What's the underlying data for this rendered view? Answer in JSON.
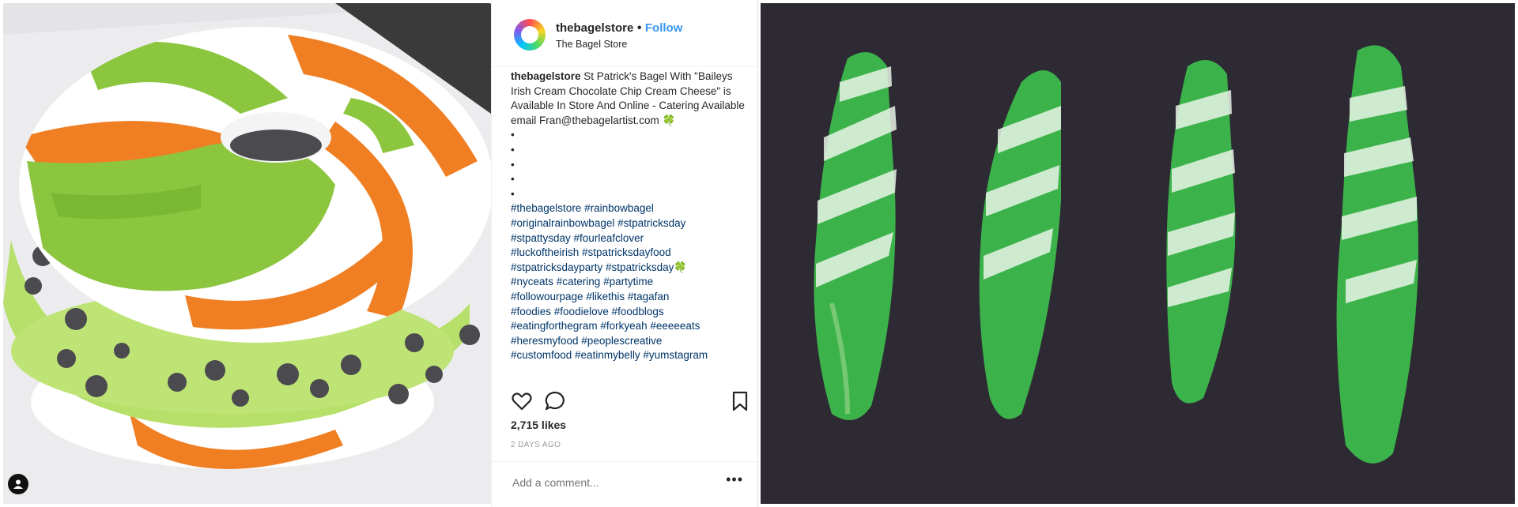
{
  "post": {
    "username": "thebagelstore",
    "separator": "•",
    "follow_label": "Follow",
    "location": "The Bagel Store",
    "caption_user": "thebagelstore",
    "caption_text": "St Patrick's Bagel With \"Baileys Irish Cream Chocolate Chip Cream Cheese\" is Available In Store And Online - Catering Available email Fran@thebagelartist.com 🍀",
    "bullets": [
      "•",
      "•",
      "•",
      "•",
      "•"
    ],
    "hashtags_lines": [
      "#thebagelstore #rainbowbagel",
      "#originalrainbowbagel #stpatricksday",
      "#stpattysday #fourleafclover",
      "#luckoftheirish #stpatricksdayfood",
      "#stpatricksdayparty #stpatricksday🍀",
      "#nyceats #catering #partytime",
      "#followourpage #likethis #tagafan",
      "#foodies #foodielove #foodblogs",
      "#eatingforthegram #forkyeah #eeeeeats",
      "#heresmyfood #peoplescreative",
      "#customfood #eatinmybelly #yumstagram"
    ],
    "likes": "2,715 likes",
    "time_ago": "2 DAYS AGO",
    "comment_placeholder": "Add a comment...",
    "more_label": "•••"
  },
  "icons": {
    "like": "heart-icon",
    "comment": "comment-bubble-icon",
    "save": "bookmark-icon",
    "tagged": "person-tag-icon"
  },
  "colors": {
    "follow_blue": "#3897f0",
    "hashtag_blue": "#003569",
    "bagel_green": "#8cc63f",
    "bagel_orange": "#f07f24",
    "cookie_green": "#3cb34a",
    "tray_dark": "#2e2a34"
  }
}
